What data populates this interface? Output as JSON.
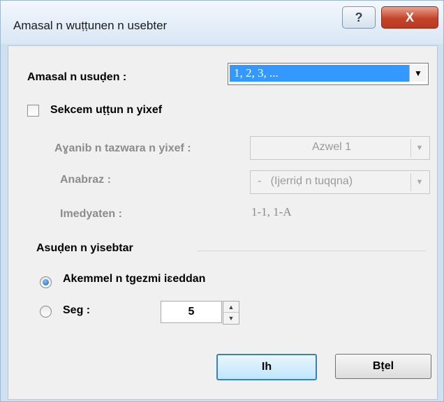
{
  "window": {
    "title": "Amasal n wuṭṭunen n usebter",
    "help_glyph": "?",
    "close_glyph": "X"
  },
  "format": {
    "label": "Amasal n usuḍen :",
    "value": "1, 2, 3, ...",
    "dropdown_glyph": "▼"
  },
  "chapter": {
    "checkbox_label": "Sekcem uṭṭun n yixef",
    "style_label": "Aɣanib n tazwara n yixef :",
    "style_value": "Azwel 1",
    "separator_label": "Anabraz :",
    "separator_value": "-   (Ijerriḍ n tuqqna)",
    "examples_label": "Imedyaten :",
    "examples_value": "1-1, 1-A",
    "disabled_arrow_glyph": "▼"
  },
  "page_numbering": {
    "group_label": "Asuḍen n yisebtar",
    "continue_label": "Akemmel n tgezmi iɛeddan",
    "start_at_label": "Seg :",
    "start_at_value": "5",
    "spin_up_glyph": "▲",
    "spin_down_glyph": "▼"
  },
  "buttons": {
    "ok_label": "Ih",
    "cancel_label": "Bṭel"
  }
}
